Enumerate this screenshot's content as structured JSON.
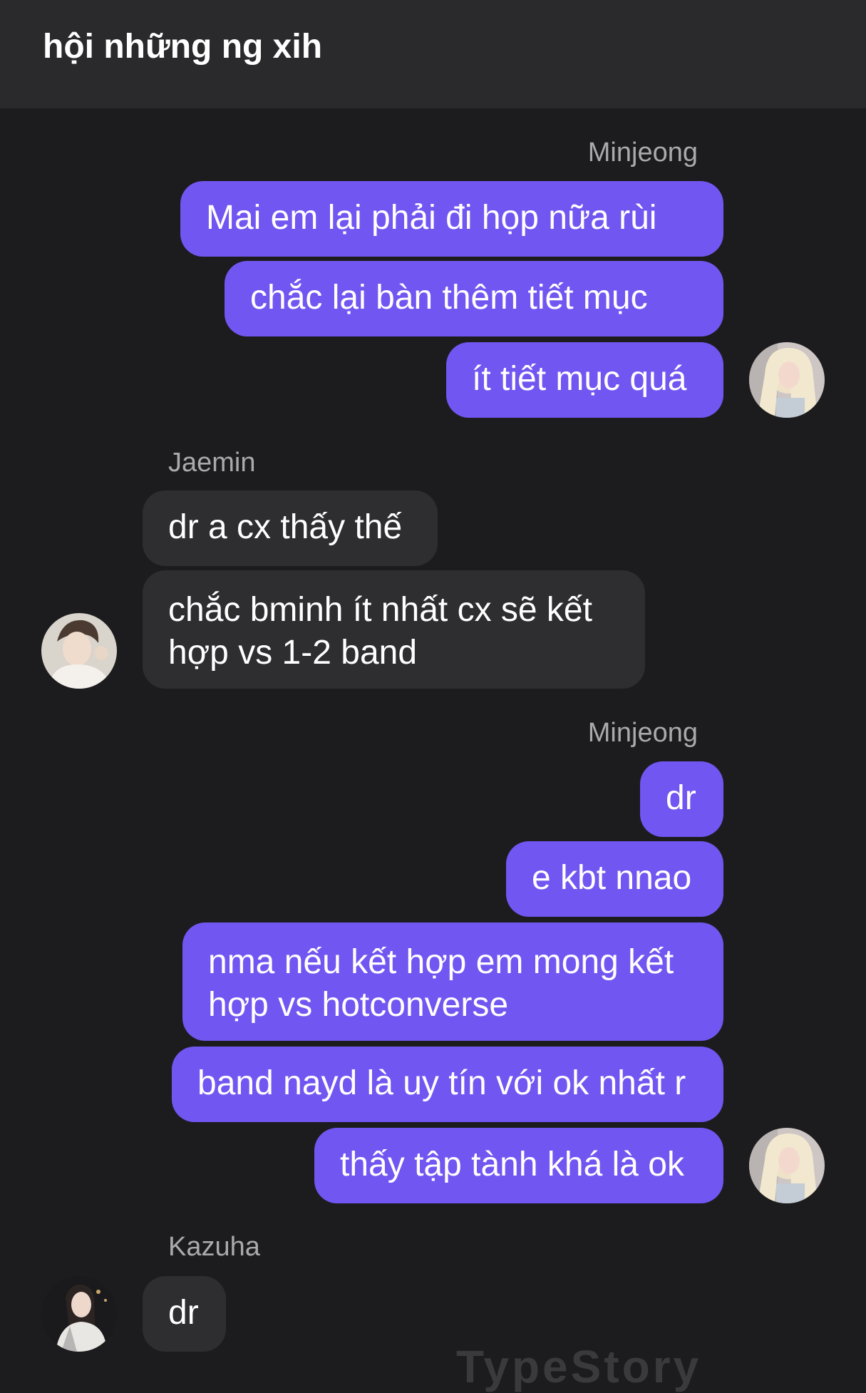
{
  "header": {
    "title": "hội những ng xih"
  },
  "messages": [
    {
      "sender": "Minjeong",
      "side": "right",
      "bubbles": [
        "Mai em lại phải đi họp nữa rùi",
        "chắc lại bàn thêm tiết mục",
        "ít tiết mục quá"
      ]
    },
    {
      "sender": "Jaemin",
      "side": "left",
      "bubbles": [
        "dr a cx thấy thế",
        "chắc bminh ít nhất cx sẽ kết hợp vs 1-2 band"
      ]
    },
    {
      "sender": "Minjeong",
      "side": "right",
      "bubbles": [
        "dr",
        "e kbt nnao",
        "nma nếu kết hợp em mong kết hợp vs hotconverse",
        "band nayd là uy tín với ok nhất r",
        "thấy tập tành khá là ok"
      ]
    },
    {
      "sender": "Kazuha",
      "side": "left",
      "bubbles": [
        "dr"
      ]
    }
  ],
  "watermark": "TypeStory",
  "colors": {
    "outgoing_bubble": "#7256f1",
    "incoming_bubble": "#2e2e31",
    "background": "#1c1c1e",
    "header": "#2a2a2c"
  }
}
